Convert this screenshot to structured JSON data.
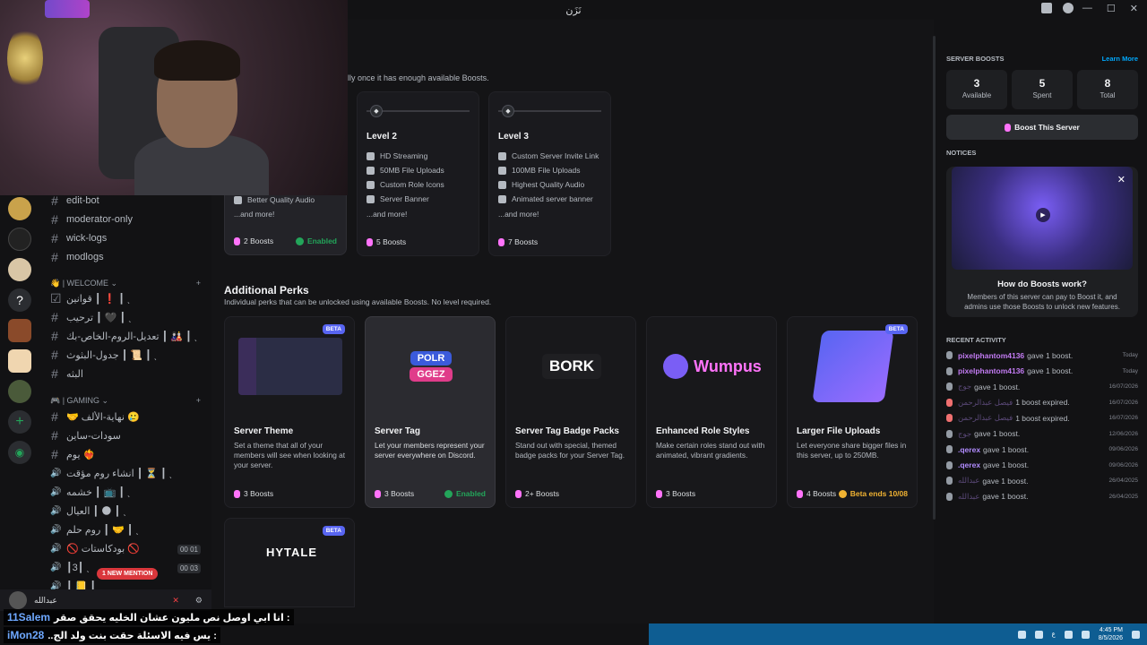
{
  "title_bar": {
    "title": "نَزَن",
    "min": "—",
    "max": "☐",
    "close": "✕"
  },
  "channels": {
    "items": [
      {
        "type": "text",
        "label": "edit-bot"
      },
      {
        "type": "text",
        "label": "moderator-only"
      },
      {
        "type": "text",
        "label": "wick-logs"
      },
      {
        "type": "text",
        "label": "modlogs"
      }
    ],
    "cat_welcome": "👋 | WELCOME ⌄",
    "welcome_items": [
      {
        "type": "rules",
        "label": "قوانين ┃ ❗ ┃ ˎ"
      },
      {
        "type": "text",
        "label": "ترحيب ┃ 🖤 ┃ ˎ"
      },
      {
        "type": "text",
        "label": "تعديل-الروم-الخاص-بك ┃ 🎎 ┃ ˎ"
      },
      {
        "type": "text",
        "label": "جدول-البثوث ┃ 📜 ┃ ˎ"
      },
      {
        "type": "text",
        "label": "البثه"
      }
    ],
    "cat_gaming": "🎮 | GAMING ⌄",
    "gaming_items": [
      {
        "type": "text",
        "label": "🤝 نهاية-الألف 🥲"
      },
      {
        "type": "text",
        "label": "سودات-ساين"
      },
      {
        "type": "text",
        "label": "يوم ❤️‍🔥"
      },
      {
        "type": "voice",
        "label": "انشاء روم مؤقت ┃ ⏳ ┃ ˎ"
      },
      {
        "type": "voice",
        "label": "خشمه ┃ 📺 ┃ ˎ"
      },
      {
        "type": "voice",
        "label": "العيال ┃ 🌑 ┃ ˎ"
      },
      {
        "type": "voice",
        "label": "روم حلم ┃ 🤝 ┃ ˎ"
      },
      {
        "type": "voice",
        "label": "🚫 بودكاستات 🚫"
      },
      {
        "type": "voice",
        "label": "┃3┃ ˎ"
      },
      {
        "type": "voice",
        "label": "┃ 📒 ┃ ˎ"
      }
    ],
    "counts": [
      {
        "label": "00  01"
      },
      {
        "label": "00  03"
      }
    ],
    "mention_badge": "1 NEW MENTION"
  },
  "user_panel": {
    "name": "عبدالله"
  },
  "chat_overlay": [
    {
      "name": "11Salem",
      "message": "انا ابي اوصل نص مليون عشان الخليه يحقق صقر :"
    },
    {
      "name": "iMon28",
      "message": "..يس فيه الاسئلة حقت بنت ولد الج :"
    }
  ],
  "main": {
    "note_top": "lly once it has enough available Boosts.",
    "level1": {
      "perks": [
        {
          "icon": "headphones-icon",
          "label": "Better Quality Audio"
        }
      ],
      "more": "...and more!",
      "cost": "2 Boosts",
      "status": "Enabled"
    },
    "level2": {
      "title": "Level 2",
      "perks": [
        {
          "icon": "stream-icon",
          "label": "HD Streaming"
        },
        {
          "icon": "upload-icon",
          "label": "50MB File Uploads"
        },
        {
          "icon": "role-icon",
          "label": "Custom Role Icons"
        },
        {
          "icon": "image-icon",
          "label": "Server Banner"
        }
      ],
      "more": "...and more!",
      "cost": "5 Boosts"
    },
    "level3": {
      "title": "Level 3",
      "perks": [
        {
          "icon": "star-icon",
          "label": "Custom Server Invite Link"
        },
        {
          "icon": "upload-icon",
          "label": "100MB File Uploads"
        },
        {
          "icon": "headphones-icon",
          "label": "Highest Quality Audio"
        },
        {
          "icon": "image-icon",
          "label": "Animated server banner"
        }
      ],
      "more": "...and more!",
      "cost": "7 Boosts"
    },
    "additional_title": "Additional Perks",
    "additional_sub": "Individual perks that can be unlocked using available Boosts. No level required.",
    "perks": [
      {
        "title": "Server Theme",
        "desc": "Set a theme that all of your members will see when looking at your server.",
        "cost": "3 Boosts",
        "beta": "BETA"
      },
      {
        "title": "Server Tag",
        "desc": "Let your members represent your server everywhere on Discord.",
        "cost": "3 Boosts",
        "status": "Enabled",
        "tag1": "POLR",
        "tag2": "GGEZ"
      },
      {
        "title": "Server Tag Badge Packs",
        "desc": "Stand out with special, themed badge packs for your Server Tag.",
        "cost": "2+ Boosts",
        "art": "BORK"
      },
      {
        "title": "Enhanced Role Styles",
        "desc": "Make certain roles stand out with animated, vibrant gradients.",
        "cost": "3 Boosts",
        "art": "Wumpus"
      },
      {
        "title": "Larger File Uploads",
        "desc": "Let everyone share bigger files in this server, up to 250MB.",
        "cost": "4 Boosts",
        "beta": "BETA",
        "beta_end": "Beta ends 10/08"
      }
    ],
    "extra_card": {
      "beta": "BETA",
      "art": "HYTALE"
    }
  },
  "right_panel": {
    "boosts_header": "SERVER BOOSTS",
    "learn_more": "Learn More",
    "stats": [
      {
        "num": "3",
        "label": "Available"
      },
      {
        "num": "5",
        "label": "Spent"
      },
      {
        "num": "8",
        "label": "Total"
      }
    ],
    "boost_button": "Boost This Server",
    "notices_header": "NOTICES",
    "notice_title": "How do Boosts work?",
    "notice_text": "Members of this server can pay to Boost it, and admins use those Boosts to unlock new features.",
    "recent_header": "RECENT ACTIVITY",
    "activity": [
      {
        "who": "pixelphantom4136",
        "what": "gave 1 boost.",
        "date": "Today",
        "style": "bright",
        "expired": false
      },
      {
        "who": "pixelphantom4136",
        "what": "gave 1 boost.",
        "date": "Today",
        "style": "bright",
        "expired": false
      },
      {
        "who": "جوج",
        "what": "gave 1 boost.",
        "date": "16/07/2026",
        "style": "faint",
        "expired": false
      },
      {
        "who": "فيصل عبدالرحمن",
        "what": "1 boost expired.",
        "date": "16/07/2026",
        "style": "faint",
        "expired": true
      },
      {
        "who": "فيصل عبدالرحمن",
        "what": "1 boost expired.",
        "date": "16/07/2026",
        "style": "faint",
        "expired": true
      },
      {
        "who": "جوج",
        "what": "gave 1 boost.",
        "date": "12/06/2026",
        "style": "faint",
        "expired": false
      },
      {
        "who": ".qerex",
        "what": "gave 1 boost.",
        "date": "09/06/2026",
        "style": "blue",
        "expired": false
      },
      {
        "who": ".qerex",
        "what": "gave 1 boost.",
        "date": "09/06/2026",
        "style": "blue",
        "expired": false
      },
      {
        "who": "عبدالله",
        "what": "gave 1 boost.",
        "date": "26/04/2025",
        "style": "faint",
        "expired": false
      },
      {
        "who": "عبدالله",
        "what": "gave 1 boost.",
        "date": "26/04/2025",
        "style": "faint",
        "expired": false
      }
    ]
  },
  "taskbar": {
    "time": "4:45 PM",
    "date": "8/5/2026",
    "lang": "ع"
  },
  "colors": {
    "accent": "#5865f2",
    "boost_pink": "#ff73fa",
    "enabled_green": "#23a55a",
    "warn": "#f0b232",
    "taskbar": "#0e5d92"
  }
}
